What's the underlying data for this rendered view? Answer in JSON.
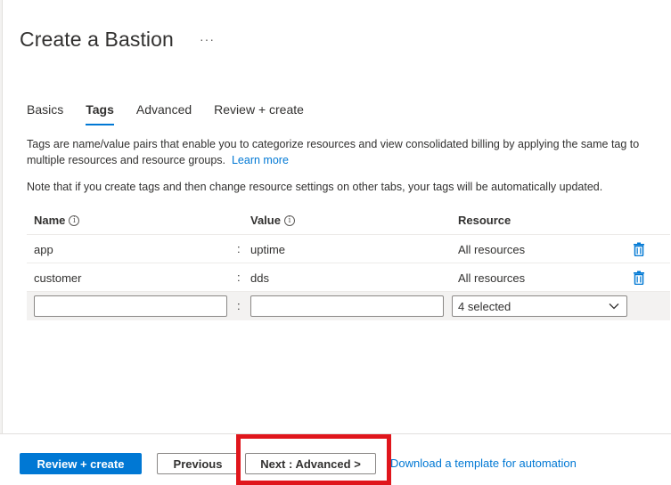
{
  "header": {
    "title": "Create a Bastion",
    "more_label": "···"
  },
  "tabs": [
    {
      "label": "Basics",
      "active": false
    },
    {
      "label": "Tags",
      "active": true
    },
    {
      "label": "Advanced",
      "active": false
    },
    {
      "label": "Review + create",
      "active": false
    }
  ],
  "description": {
    "text": "Tags are name/value pairs that enable you to categorize resources and view consolidated billing by applying the same tag to multiple resources and resource groups.",
    "link": "Learn more"
  },
  "note": "Note that if you create tags and then change resource settings on other tabs, your tags will be automatically updated.",
  "table": {
    "columns": [
      "Name",
      "Value",
      "Resource"
    ],
    "separator": ":",
    "rows": [
      {
        "name": "app",
        "value": "uptime",
        "resource": "All resources"
      },
      {
        "name": "customer",
        "value": "dds",
        "resource": "All resources"
      }
    ],
    "new_row": {
      "name_value": "",
      "value_value": "",
      "resource_selected": "4 selected"
    }
  },
  "footer": {
    "review_create": "Review + create",
    "previous": "Previous",
    "next": "Next : Advanced >",
    "download_link": "Download a template for automation"
  },
  "colors": {
    "accent": "#0078d4",
    "highlight": "#e0161c"
  }
}
